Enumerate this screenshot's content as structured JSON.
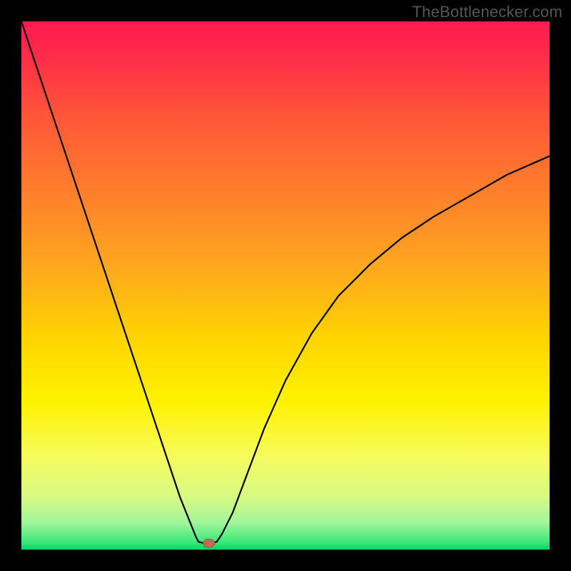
{
  "watermark": {
    "text": "TheBottlenecker.com"
  },
  "chart_data": {
    "type": "line",
    "title": "",
    "xlabel": "",
    "ylabel": "",
    "xlim": [
      0,
      100
    ],
    "ylim": [
      0,
      100
    ],
    "gradient_stops": [
      {
        "offset": 0,
        "color": "#ff1a4f"
      },
      {
        "offset": 0.06,
        "color": "#ff2a4a"
      },
      {
        "offset": 0.18,
        "color": "#ff5638"
      },
      {
        "offset": 0.32,
        "color": "#ff7e2c"
      },
      {
        "offset": 0.46,
        "color": "#ffa61f"
      },
      {
        "offset": 0.6,
        "color": "#ffd400"
      },
      {
        "offset": 0.72,
        "color": "#fff200"
      },
      {
        "offset": 0.82,
        "color": "#f7fb5a"
      },
      {
        "offset": 0.9,
        "color": "#d8fa84"
      },
      {
        "offset": 0.95,
        "color": "#9ef59a"
      },
      {
        "offset": 0.985,
        "color": "#3fe87a"
      },
      {
        "offset": 1.0,
        "color": "#00d964"
      }
    ],
    "series": [
      {
        "name": "bottleneck-curve",
        "x": [
          0,
          3,
          6,
          9,
          12,
          15,
          18,
          21,
          24,
          27,
          30,
          33,
          33.5,
          34.5,
          36,
          37,
          38,
          40,
          43,
          46,
          50,
          55,
          60,
          66,
          72,
          78,
          85,
          92,
          100
        ],
        "y": [
          100,
          91,
          82,
          73,
          64,
          55,
          46,
          37,
          28,
          19,
          10,
          2.5,
          1.5,
          1.2,
          1.2,
          1.5,
          3,
          7,
          15,
          23,
          32,
          41,
          48,
          54,
          59,
          63,
          67,
          71,
          74.5
        ]
      }
    ],
    "marker": {
      "x": 35.5,
      "y": 1.2,
      "color": "#c56a56"
    }
  }
}
